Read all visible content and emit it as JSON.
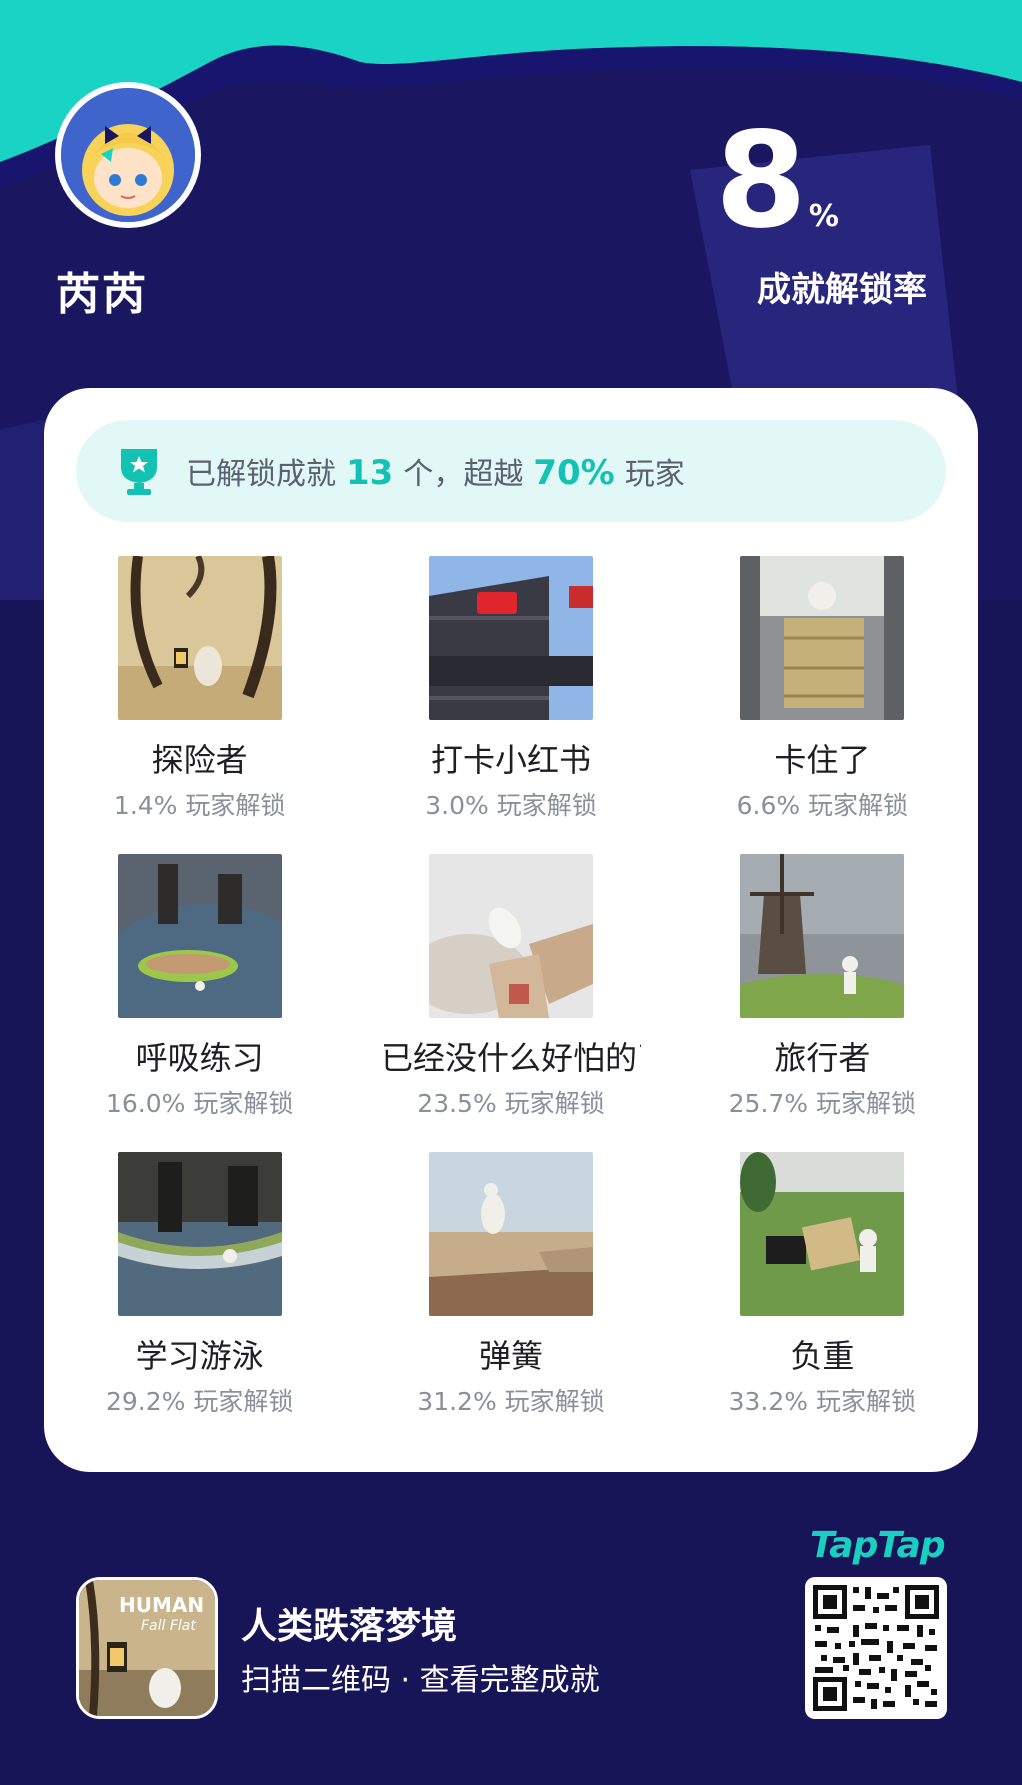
{
  "colors": {
    "background": "#1a1760",
    "accent_teal": "#19d4c4",
    "highlight": "#14c2b3",
    "card": "#ffffff",
    "summary_bg": "#e2f8f6"
  },
  "profile": {
    "username": "芮芮",
    "avatar_icon": "avatar-character-icon"
  },
  "stats": {
    "unlock_rate_value": "8",
    "unlock_rate_unit": "%",
    "unlock_rate_label": "成就解锁率"
  },
  "summary": {
    "icon": "trophy-icon",
    "prefix": "已解锁成就",
    "count": "13",
    "mid": "个，超越",
    "percent": "70%",
    "suffix": "玩家"
  },
  "achievements": [
    {
      "name": "探险者",
      "pct": "1.4% 玩家解锁",
      "thumb": "cave-lantern-scene"
    },
    {
      "name": "打卡小红书",
      "pct": "3.0% 玩家解锁",
      "thumb": "inspire-lives-building"
    },
    {
      "name": "卡住了",
      "pct": "6.6% 玩家解锁",
      "thumb": "stuck-crate-scene"
    },
    {
      "name": "呼吸练习",
      "pct": "16.0% 玩家解锁",
      "thumb": "boat-in-water"
    },
    {
      "name": "已经没什么好怕的了",
      "pct": "23.5% 玩家解锁",
      "thumb": "falling-in-sky"
    },
    {
      "name": "旅行者",
      "pct": "25.7% 玩家解锁",
      "thumb": "windmill-hill"
    },
    {
      "name": "学习游泳",
      "pct": "29.2% 玩家解锁",
      "thumb": "rowboat-scene"
    },
    {
      "name": "弹簧",
      "pct": "31.2% 玩家解锁",
      "thumb": "jumping-desert"
    },
    {
      "name": "负重",
      "pct": "33.2% 玩家解锁",
      "thumb": "carrying-crate"
    }
  ],
  "footer": {
    "game_title": "人类跌落梦境",
    "game_subtitle": "扫描二维码 · 查看完整成就",
    "game_icon_text_1": "HUMAN",
    "game_icon_text_2": "Fall Flat",
    "brand": "TapTap",
    "qr_icon": "qr-code-icon"
  }
}
